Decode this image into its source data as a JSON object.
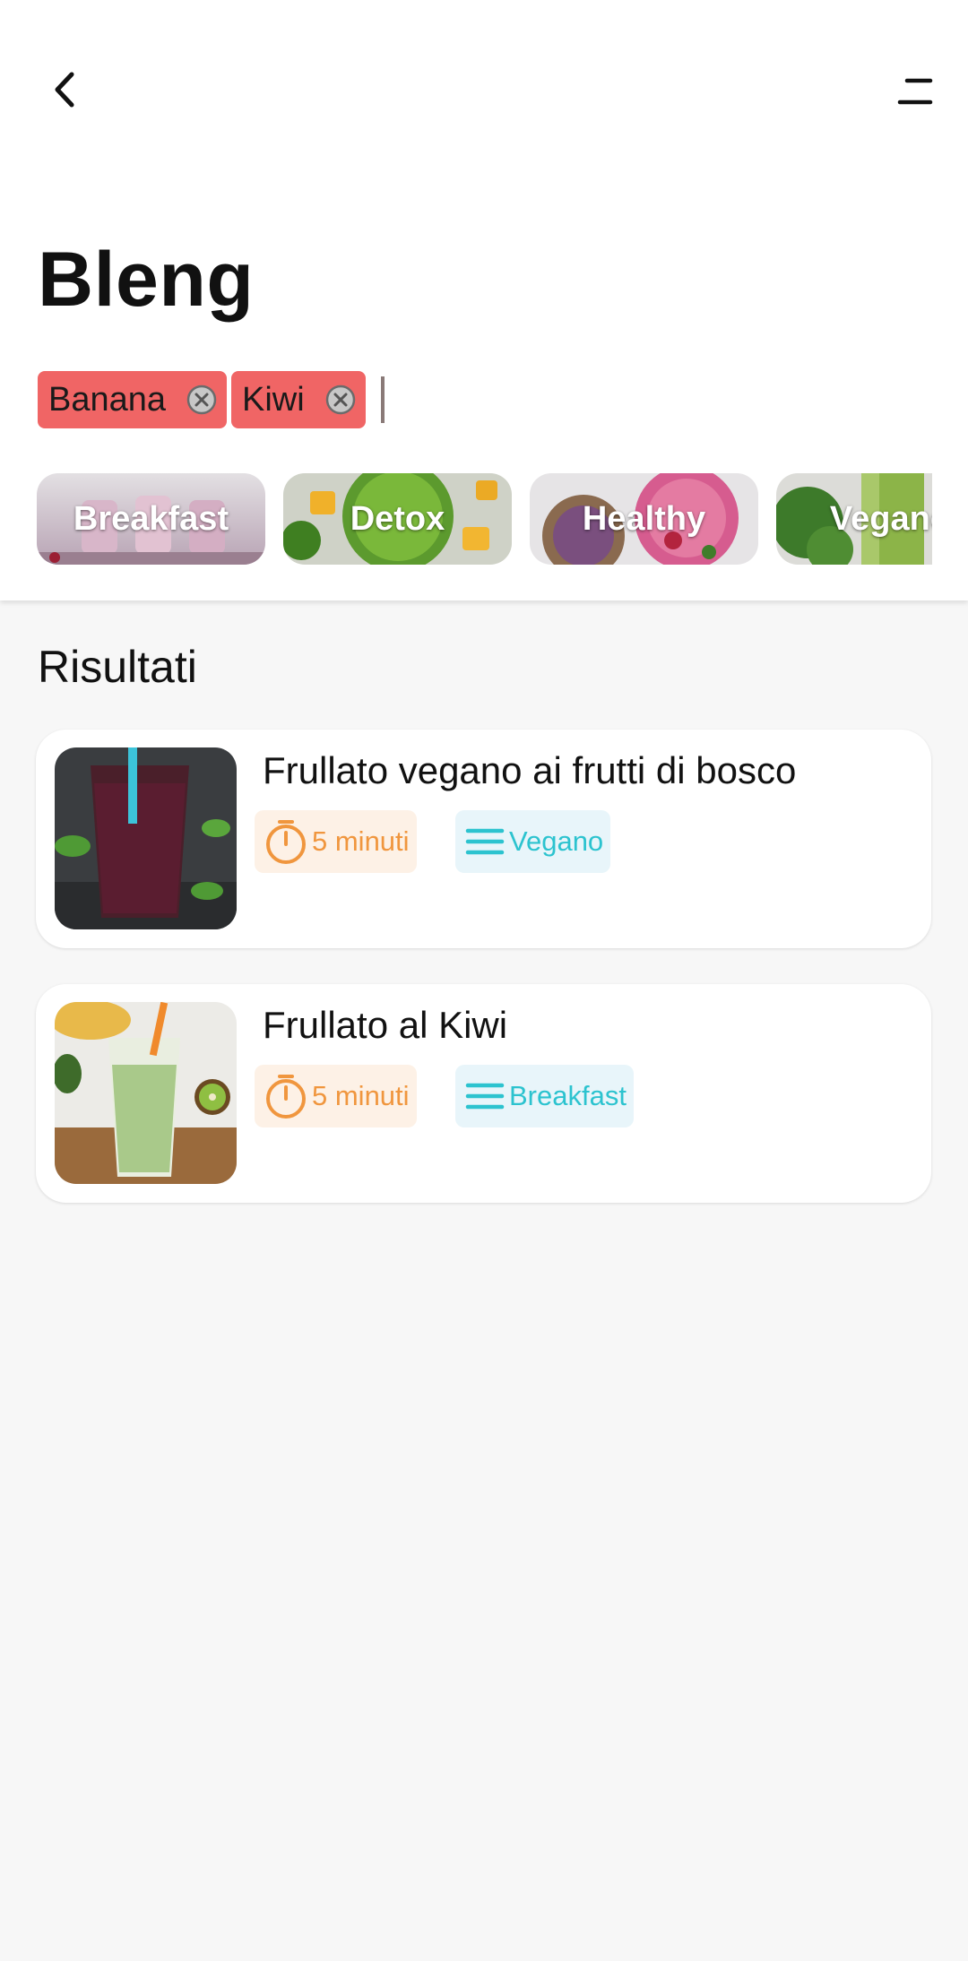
{
  "header": {
    "back_icon": "chevron-left-icon",
    "menu_icon": "menu-icon"
  },
  "app": {
    "title": "Bleng"
  },
  "ingredients": {
    "chips": [
      {
        "label": "Banana",
        "remove_icon": "close-circle-icon"
      },
      {
        "label": "Kiwi",
        "remove_icon": "close-circle-icon"
      }
    ],
    "input_value": ""
  },
  "categories": [
    {
      "label": "Breakfast"
    },
    {
      "label": "Detox"
    },
    {
      "label": "Healthy"
    },
    {
      "label": "Vegano"
    }
  ],
  "results": {
    "title": "Risultati",
    "items": [
      {
        "title": "Frullato vegano ai frutti di bosco",
        "time": "5 minuti",
        "category": "Vegano",
        "time_icon": "stopwatch-icon",
        "category_icon": "list-icon"
      },
      {
        "title": "Frullato al Kiwi",
        "time": "5 minuti",
        "category": "Breakfast",
        "time_icon": "stopwatch-icon",
        "category_icon": "list-icon"
      }
    ]
  },
  "colors": {
    "chip": "#f06565",
    "time_badge_bg": "#fdf1e6",
    "time_badge_fg": "#f0963e",
    "category_badge_bg": "#e8f5fa",
    "category_badge_fg": "#2cc3cf",
    "background": "#f7f7f7"
  }
}
